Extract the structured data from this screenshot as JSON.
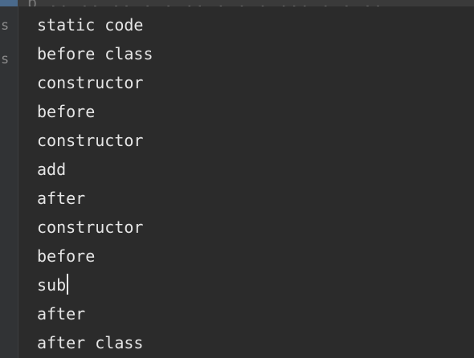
{
  "top_strip": {
    "partial_text": "p      ,,  ,,  ,, ,  ,  ,,  ,  ,  ,  ,,,  ,  ,  ,,"
  },
  "gutter": {
    "letters": [
      "s",
      "s"
    ]
  },
  "console": {
    "lines": [
      "static code",
      "before class",
      "constructor",
      "before",
      "constructor",
      "add",
      "after",
      "constructor",
      "before",
      "sub",
      "after",
      "after class"
    ],
    "caret_line_index": 9
  },
  "colors": {
    "background": "#2b2b2b",
    "gutter": "#313335",
    "text": "#e6e6e6",
    "accent": "#4a6a8c"
  }
}
